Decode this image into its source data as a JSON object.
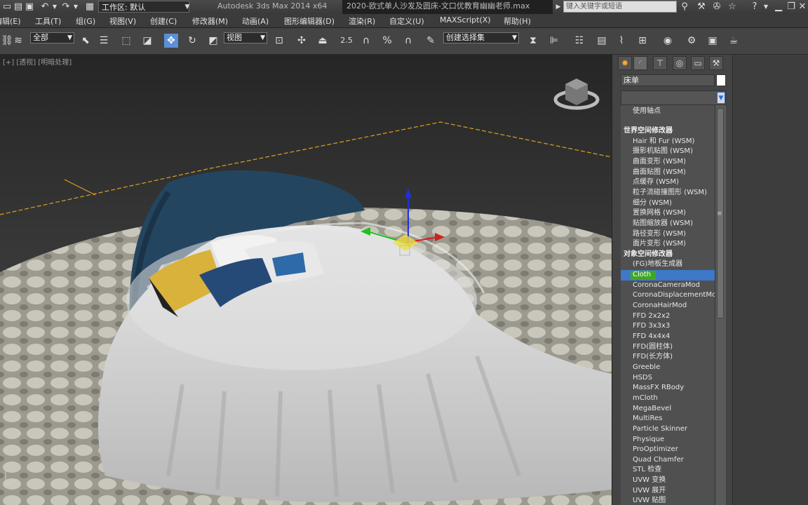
{
  "titlebar": {
    "workspace_label": "工作区: 默认",
    "app_title": "Autodesk 3ds Max  2014 x64",
    "file_title": "2020-欧式单人沙发及圆床-文口优教育幽幽老师.max",
    "search_placeholder": "键入关键字或短语"
  },
  "menubar": {
    "items": [
      "编辑(E)",
      "工具(T)",
      "组(G)",
      "视图(V)",
      "创建(C)",
      "修改器(M)",
      "动画(A)",
      "图形编辑器(D)",
      "渲染(R)",
      "自定义(U)",
      "MAXScript(X)",
      "帮助(H)"
    ]
  },
  "toolbar": {
    "selection_filter": "全部",
    "ref_coord": "视图",
    "named_selection": "创建选择集",
    "snap_value": "2.5"
  },
  "viewport": {
    "label": "[+] [透视] [明暗处理]"
  },
  "command_panel": {
    "object_name": "床单",
    "object_color": "#ffffff",
    "modifier_items": [
      {
        "text": "使用轴点",
        "type": "pivot"
      },
      {
        "text": "世界空间修改器",
        "type": "header"
      },
      {
        "text": "Hair 和 Fur (WSM)",
        "type": "item"
      },
      {
        "text": "摄影机贴图 (WSM)",
        "type": "item"
      },
      {
        "text": "曲面变形 (WSM)",
        "type": "item"
      },
      {
        "text": "曲面贴图 (WSM)",
        "type": "item"
      },
      {
        "text": "点缓存 (WSM)",
        "type": "item"
      },
      {
        "text": "粒子流碰撞图形 (WSM)",
        "type": "item"
      },
      {
        "text": "细分 (WSM)",
        "type": "item"
      },
      {
        "text": "置换网格 (WSM)",
        "type": "item"
      },
      {
        "text": "贴图缩放器 (WSM)",
        "type": "item"
      },
      {
        "text": "路径变形 (WSM)",
        "type": "item"
      },
      {
        "text": "面片变形 (WSM)",
        "type": "item"
      },
      {
        "text": "对象空间修改器",
        "type": "header"
      },
      {
        "text": "(FG)地板生成器",
        "type": "item"
      },
      {
        "text": "Cloth",
        "type": "selected"
      },
      {
        "text": "CoronaCameraMod",
        "type": "item"
      },
      {
        "text": "CoronaDisplacementMod",
        "type": "item"
      },
      {
        "text": "CoronaHairMod",
        "type": "item"
      },
      {
        "text": "FFD 2x2x2",
        "type": "item"
      },
      {
        "text": "FFD 3x3x3",
        "type": "item"
      },
      {
        "text": "FFD 4x4x4",
        "type": "item"
      },
      {
        "text": "FFD(圆柱体)",
        "type": "item"
      },
      {
        "text": "FFD(长方体)",
        "type": "item"
      },
      {
        "text": "Greeble",
        "type": "item"
      },
      {
        "text": "HSDS",
        "type": "item"
      },
      {
        "text": "MassFX RBody",
        "type": "item"
      },
      {
        "text": "mCloth",
        "type": "item"
      },
      {
        "text": "MegaBevel",
        "type": "item"
      },
      {
        "text": "MultiRes",
        "type": "item"
      },
      {
        "text": "Particle Skinner",
        "type": "item"
      },
      {
        "text": "Physique",
        "type": "item"
      },
      {
        "text": "ProOptimizer",
        "type": "item"
      },
      {
        "text": "Quad Chamfer",
        "type": "item"
      },
      {
        "text": "STL 检查",
        "type": "item"
      },
      {
        "text": "UVW 变换",
        "type": "item"
      },
      {
        "text": "UVW 展开",
        "type": "item"
      },
      {
        "text": "UVW 贴图",
        "type": "item"
      }
    ]
  }
}
